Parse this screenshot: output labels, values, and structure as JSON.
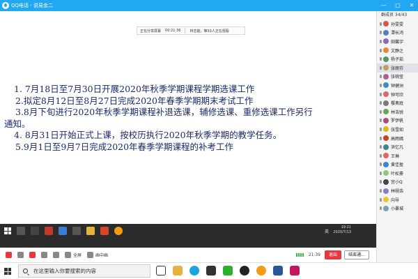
{
  "window": {
    "title": "QQ电话 - 说易金二"
  },
  "share_bar": {
    "status": "正在分享屏幕",
    "elapsed": "00:21:36",
    "viewers": "林志能、等33人正在观看"
  },
  "slide": {
    "lines": [
      "1. 7月18日至7月30日开展2020年秋季学期课程学期选课工作",
      "2.拟定8月12日至8月27日完成2020年春季学期期末考试工作",
      "3.8月下旬进行2020年秋季学期课程补退选课，辅修选课、重修选课工作另行",
      "通知。",
      "4. 8月31日开始正式上课，按校历执行2020年秋季学期的教学任务。",
      "5.9月1日至9月7日完成2020年春季学期课程的补考工作"
    ]
  },
  "inner_taskbar": {
    "lang": "英",
    "time": "19:21",
    "date": "2020/7/13"
  },
  "meeting_bar": {
    "fullscreen": "全屏",
    "gallery": "画中画",
    "clock": "21:39",
    "exit": "退出",
    "end": "结束通..."
  },
  "members": {
    "header": "群成员 34/43",
    "list": [
      {
        "name": "孙雯雯",
        "color": "#d9534f"
      },
      {
        "name": "潭长鸿",
        "color": "#5b7db8"
      },
      {
        "name": "田馨宇",
        "color": "#8c6bb1"
      },
      {
        "name": "文静之",
        "color": "#e08a3c"
      },
      {
        "name": "杨子茹",
        "color": "#4a9a6b"
      },
      {
        "name": "张丽芬",
        "color": "#c0a060"
      },
      {
        "name": "张桃莹",
        "color": "#b05f8a"
      },
      {
        "name": "钟健洲",
        "color": "#3c8dbc"
      },
      {
        "name": "钟可欣",
        "color": "#d46a6a"
      },
      {
        "name": "樱奥庭",
        "color": "#7a7a7a"
      },
      {
        "name": "林浩锐",
        "color": "#6aa84f"
      },
      {
        "name": "罗伊帆",
        "color": "#a64d79"
      },
      {
        "name": "张雪如",
        "color": "#e6b422"
      },
      {
        "name": "高雨嫣",
        "color": "#cc4125"
      },
      {
        "name": "洪忆凡",
        "color": "#45818e"
      },
      {
        "name": "王琳",
        "color": "#e06666"
      },
      {
        "name": "黄佳盈",
        "color": "#3d85c6"
      },
      {
        "name": "叶松豪",
        "color": "#93c47d"
      },
      {
        "name": "宫小Q",
        "color": "#444444"
      },
      {
        "name": "林栩浩",
        "color": "#8e7cc3"
      },
      {
        "name": "向导",
        "color": "#f1c232"
      },
      {
        "name": "小暴城",
        "color": "#76a5af"
      }
    ]
  },
  "host_taskbar": {
    "search_placeholder": "在这里输入你要搜索的内容"
  },
  "colors": {
    "qq_blue": "#22a7f2",
    "slide_text": "#1a2a6c",
    "exit_red": "#e8383d"
  }
}
